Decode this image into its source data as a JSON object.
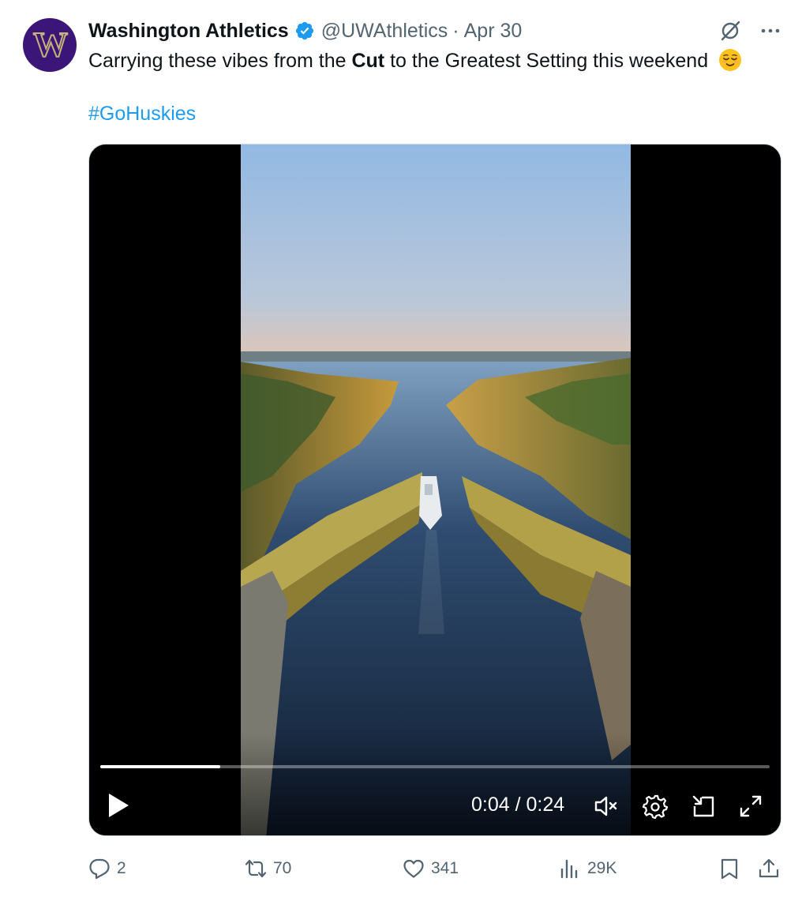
{
  "tweet": {
    "avatar_letter": "W",
    "display_name": "Washington Athletics",
    "handle": "@UWAthletics",
    "separator": "·",
    "date": "Apr 30",
    "text_before": "Carrying these vibes from the ",
    "text_bold": "Cut",
    "text_after": " to the Greatest Setting this weekend",
    "emoji_name": "relieved-face-emoji",
    "hashtag": "#GoHuskies"
  },
  "video": {
    "time": "0:04 / 0:24",
    "progress": 0.179
  },
  "actions": {
    "replies": "2",
    "retweets": "70",
    "likes": "341",
    "views": "29K"
  },
  "colors": {
    "accent": "#1d9bf0",
    "muted": "#536471",
    "text": "#0f1419",
    "uw_purple": "#3b1578",
    "uw_gold": "#c9b27a"
  }
}
